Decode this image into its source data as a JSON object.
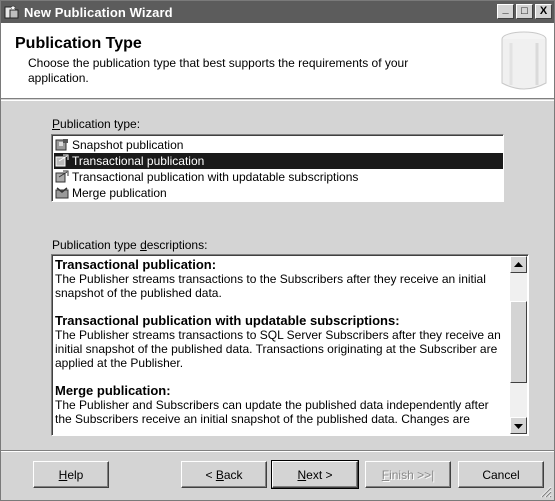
{
  "window": {
    "title": "New Publication Wizard",
    "minimize": "_",
    "maximize": "□",
    "close": "X"
  },
  "header": {
    "heading": "Publication Type",
    "subtitle": "Choose the publication type that best supports the requirements of your application."
  },
  "publication_type": {
    "label_accel": "P",
    "label_rest": "ublication type:",
    "items": [
      {
        "label": "Snapshot publication",
        "icon": "snapshot-publication-icon",
        "selected": false
      },
      {
        "label": "Transactional publication",
        "icon": "transactional-publication-icon",
        "selected": true
      },
      {
        "label": "Transactional publication with updatable subscriptions",
        "icon": "updatable-publication-icon",
        "selected": false
      },
      {
        "label": "Merge publication",
        "icon": "merge-publication-icon",
        "selected": false
      }
    ]
  },
  "descriptions": {
    "label_pre": "Publication type ",
    "label_accel": "d",
    "label_post": "escriptions:",
    "sections": [
      {
        "title": "Transactional publication:",
        "text": "The Publisher streams transactions to the Subscribers after they receive an initial snapshot of the published data."
      },
      {
        "title": "Transactional publication with updatable subscriptions:",
        "text": "The Publisher streams transactions to SQL Server Subscribers after they receive an initial snapshot of the published data. Transactions originating at the Subscriber are applied at the Publisher."
      },
      {
        "title": "Merge publication:",
        "text": "The Publisher and Subscribers can update the published data independently after the Subscribers receive an initial snapshot of the published data. Changes are"
      }
    ]
  },
  "buttons": {
    "help_accel": "H",
    "help_rest": "elp",
    "back_pre": "< ",
    "back_accel": "B",
    "back_rest": "ack",
    "next_accel": "N",
    "next_rest": "ext >",
    "finish_accel": "F",
    "finish_rest": "inish >>|",
    "cancel": "Cancel"
  },
  "colors": {
    "titlebar": "#5c5c5c",
    "face": "#d4d4d4",
    "selection": "#1a1a1a"
  }
}
